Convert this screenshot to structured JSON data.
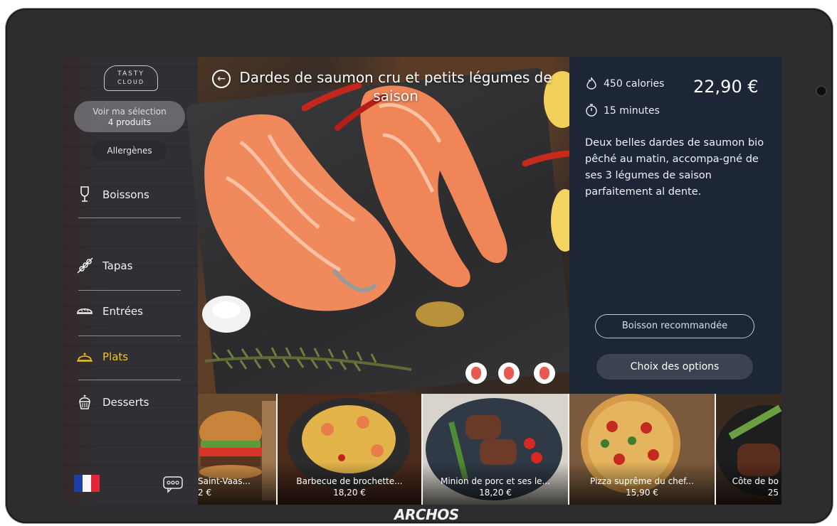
{
  "device": {
    "brand": "ARCHOS"
  },
  "logo": {
    "line1": "TASTY",
    "line2": "CLOUD"
  },
  "selection": {
    "label": "Voir ma sélection",
    "count": "4 produits"
  },
  "allergens": "Allergènes",
  "nav": [
    {
      "label": "Boissons",
      "icon": "wine-glass-icon"
    },
    {
      "label": "Tapas",
      "icon": "skewer-icon"
    },
    {
      "label": "Entrées",
      "icon": "bread-icon"
    },
    {
      "label": "Plats",
      "icon": "cloche-icon",
      "active": true
    },
    {
      "label": "Desserts",
      "icon": "cupcake-icon"
    }
  ],
  "language": {
    "flag": "french-flag-icon"
  },
  "product": {
    "title": "Dardes de saumon cru et petits légumes de saison",
    "calories": "450 calories",
    "time": "15 minutes",
    "price": "22,90 €",
    "description": "Deux belles dardes de saumon bio pêché au matin, accompa-gné de ses 3 légumes de saison parfaitement al dente.",
    "btn_drink": "Boisson recommandée",
    "btn_options": "Choix des options"
  },
  "dishes": [
    {
      "name": "Saint-Vaas...",
      "price": "2 €"
    },
    {
      "name": "Barbecue de brochette...",
      "price": "18,20 €"
    },
    {
      "name": "Minion de porc et ses le...",
      "price": "18,20 €"
    },
    {
      "name": "Pizza suprême du chef...",
      "price": "15,90 €"
    },
    {
      "name": "Côte de bo",
      "price": "25"
    }
  ],
  "colors": {
    "accent_active": "#f3c319",
    "panel_bg": "#1d2637",
    "button_outline": "#b6c9d7"
  }
}
